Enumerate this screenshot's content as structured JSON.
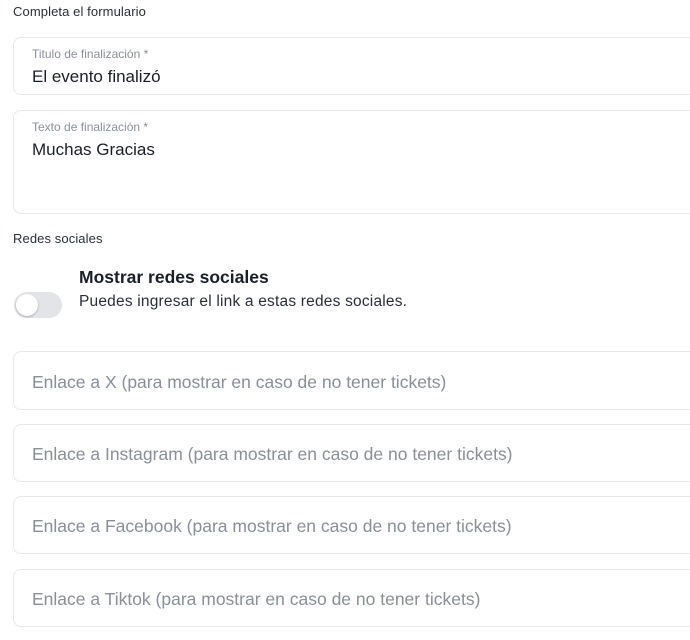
{
  "form": {
    "heading": "Completa el formulario",
    "completion_title": {
      "label": "Titulo de finalización *",
      "value": "El evento finalizó"
    },
    "completion_text": {
      "label": "Texto de finalización *",
      "value": "Muchas Gracias"
    }
  },
  "social": {
    "heading": "Redes sociales",
    "toggle": {
      "title": "Mostrar redes sociales",
      "description": "Puedes ingresar el link a estas redes sociales.",
      "enabled": false
    },
    "links": {
      "x": {
        "placeholder": "Enlace a X (para mostrar en caso de no tener tickets)"
      },
      "instagram": {
        "placeholder": "Enlace a Instagram (para mostrar en caso de no tener tickets)"
      },
      "facebook": {
        "placeholder": "Enlace a Facebook (para mostrar en caso de no tener tickets)"
      },
      "tiktok": {
        "placeholder": "Enlace a Tiktok (para mostrar en caso de no tener tickets)"
      }
    }
  },
  "colors": {
    "border": "#e6e8ec",
    "placeholder_text": "#8a8f98",
    "toggle_off": "#e3e4e8"
  }
}
